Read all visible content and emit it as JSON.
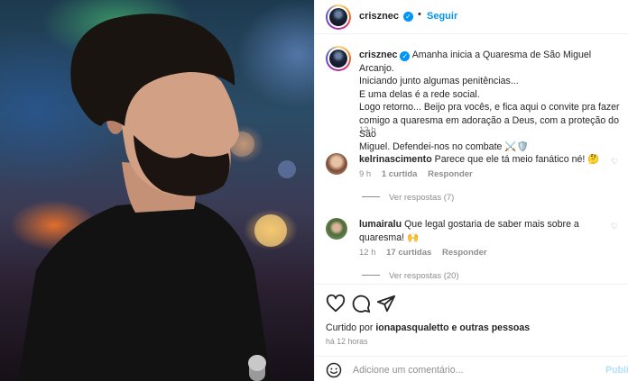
{
  "post": {
    "username": "crisznec",
    "follow_label": "Seguir",
    "separator": "•",
    "more_icon": "more-options-icon",
    "caption_lines": [
      "Amanha inicia a Quaresma de São Miguel Arcanjo.",
      "Iniciando junto algumas penitências...",
      "E uma delas é a rede social.",
      "Logo retorno... Beijo pra vocês, e fica aqui o convite pra fazer",
      "comigo a quaresma em adoração a Deus, com a proteção do São",
      "Miguel. Defendei-nos no combate ⚔️🛡️"
    ],
    "caption_time": "12 h"
  },
  "comments": [
    {
      "username": "kelrinascimento",
      "text": "Parece que ele tá meio fanático né! 🤔",
      "time": "9 h",
      "likes": "1 curtida",
      "reply_label": "Responder",
      "view_replies": "Ver respostas (7)"
    },
    {
      "username": "lumairalu",
      "text": "Que legal gostaria de saber mais sobre a quaresma! 🙌",
      "time": "12 h",
      "likes": "17 curtidas",
      "reply_label": "Responder",
      "view_replies": "Ver respostas (20)"
    }
  ],
  "actions": {
    "liked_by_prefix": "Curtido por",
    "liked_by_user": "ionapasqualetto",
    "liked_by_suffix": "e outras pessoas",
    "time_ago": "há 12 horas"
  },
  "comment_box": {
    "placeholder": "Adicione um comentário...",
    "publish_label": "Publi"
  },
  "colors": {
    "accent": "#0095f6",
    "muted": "#8e8e8e",
    "text": "#262626"
  }
}
